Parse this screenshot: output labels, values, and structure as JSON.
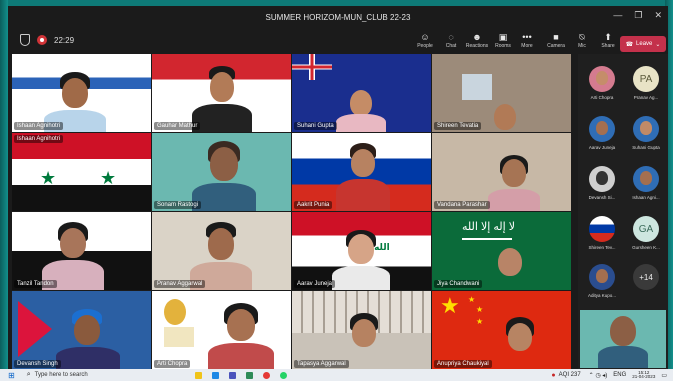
{
  "window": {
    "title": "SUMMER HORIZOM-MUN_CLUB 22-23"
  },
  "meeting": {
    "timer": "22:29"
  },
  "toolbar": {
    "people": "People",
    "chat": "Chat",
    "reactions": "Reactions",
    "rooms": "Rooms",
    "more": "More",
    "camera": "Camera",
    "mic": "Mic",
    "share": "Share",
    "leave": "Leave"
  },
  "tiles": [
    {
      "name": "Ishaan Agnihotri"
    },
    {
      "name": "Gauhar Mathur"
    },
    {
      "name": "Suhani Gupta"
    },
    {
      "name": "Shireen Tevatia"
    },
    {
      "name": "Sonam Rastogi"
    },
    {
      "name": "Aakrit Punia"
    },
    {
      "name": "Vandana Parashar"
    },
    {
      "name": "Tanzil Tandon"
    },
    {
      "name": "Pranav Aggarwal"
    },
    {
      "name": "Aarav Juneja"
    },
    {
      "name": "Jiya Chandwani"
    },
    {
      "name": "Devansh Singh"
    },
    {
      "name": "Arti Chopra"
    },
    {
      "name": "Tapasya Aggarwal"
    },
    {
      "name": "Anupriya Chaukiyal"
    }
  ],
  "sidebar": {
    "participants": [
      {
        "label": "Arti Chopra"
      },
      {
        "label": "Pranav Ag...",
        "initials": "PA"
      },
      {
        "label": "Aarav Juneja"
      },
      {
        "label": "Suhani Gupta"
      },
      {
        "label": "Devansh Si..."
      },
      {
        "label": "Ishaan Agni..."
      },
      {
        "label": "Shireen Tev..."
      },
      {
        "label": "Gursheen K...",
        "initials": "GA"
      },
      {
        "label": "Aditya Kupo..."
      }
    ],
    "overflow": "+14"
  },
  "taskbar": {
    "search_placeholder": "Type here to search",
    "aqi": "AQI 237",
    "lang": "ENG",
    "time": "15:12",
    "date": "21-04-2023"
  }
}
